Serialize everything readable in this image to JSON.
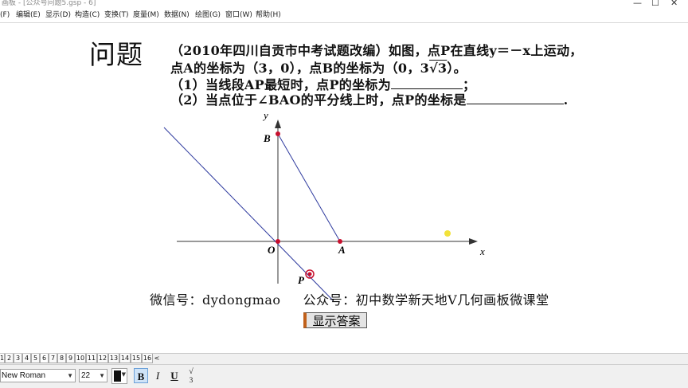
{
  "window": {
    "title": "画板 - [公众号问题5.gsp - 6]",
    "controls": [
      "—",
      "☐",
      "✕"
    ]
  },
  "menu": [
    {
      "label": "(F)"
    },
    {
      "label": "编辑(E)"
    },
    {
      "label": "显示(D)"
    },
    {
      "label": "构造(C)"
    },
    {
      "label": "变换(T)"
    },
    {
      "label": "度量(M)"
    },
    {
      "label": "数据(N)"
    },
    {
      "label": "绘图(G)"
    },
    {
      "label": "窗口(W)"
    },
    {
      "label": "帮助(H)"
    }
  ],
  "problem": {
    "heading": "问题",
    "line1": "（2010年四川自贡市中考试题改编）如图，点P在直线y＝－x上运动，",
    "line2_prefix": "点A的坐标为（3，0），点B的坐标为（0，3",
    "line2_sqrt": "√3",
    "line2_suffix": "）。",
    "line3": "（1）当线段AP最短时，点P的坐标为",
    "line3_end": "；",
    "line4": "（2）当点位于∠BAO的平分线上时，点P的坐标是",
    "line4_end": "."
  },
  "figure": {
    "axis_x_label": "x",
    "axis_y_label": "y",
    "point_labels": {
      "B": "B",
      "O": "O",
      "A": "A",
      "P": "P"
    },
    "point_color": "#c8102e",
    "line_color": "#2e3a9e",
    "highlight_point_color": "#f2e23a"
  },
  "footer": {
    "wechat_label": "微信号：",
    "wechat_id": "dydongmao",
    "official_label": "公众号：",
    "official_name": "初中数学新天地V几何画板微课堂",
    "answer_button": "显示答案"
  },
  "page_tabs": {
    "prefix": "1",
    "tabs": [
      "2",
      "3",
      "4",
      "5",
      "6",
      "7",
      "8",
      "9",
      "10",
      "11",
      "12",
      "13",
      "14",
      "15",
      "16"
    ],
    "active": "6",
    "more": "<"
  },
  "text_toolbar": {
    "font_family": "New Roman",
    "font_size": "22",
    "bold": "B",
    "italic": "I",
    "underline": "U",
    "math_format": "√",
    "math_format_sub": "3"
  }
}
